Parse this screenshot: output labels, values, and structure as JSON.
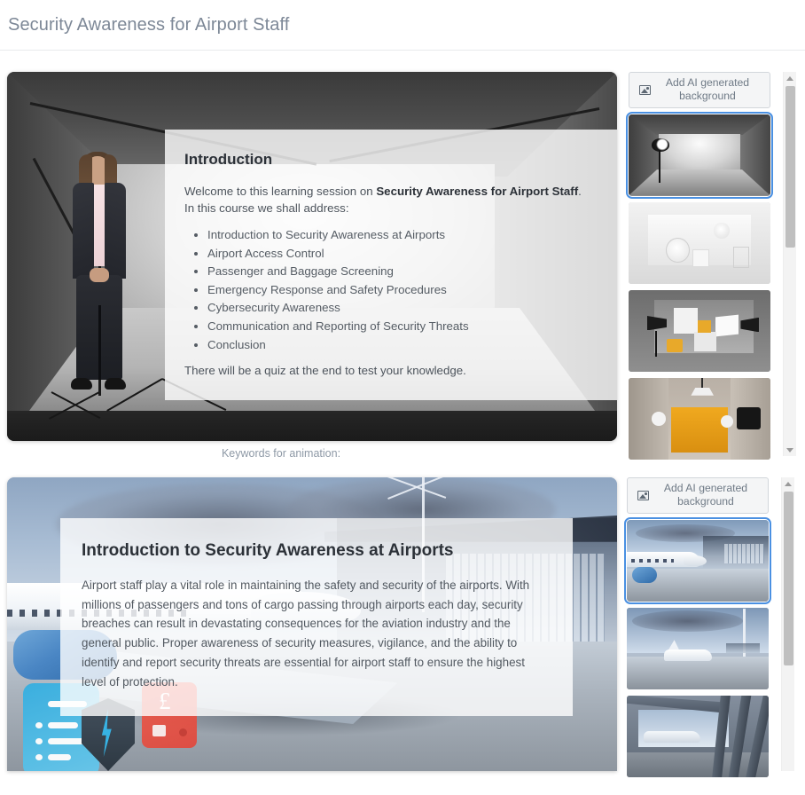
{
  "header": {
    "title": "Security Awareness for Airport Staff"
  },
  "slides": [
    {
      "heading": "Introduction",
      "intro_before": "Welcome to this learning session on ",
      "intro_bold": "Security Awareness for Airport Staff",
      "intro_after": ".",
      "intro_line2": "In this course we shall address:",
      "bullets": [
        "Introduction to Security Awareness at Airports",
        "Airport Access Control",
        "Passenger and Baggage Screening",
        "Emergency Response and Safety Procedures",
        "Cybersecurity Awareness",
        "Communication and Reporting of Security Threats",
        "Conclusion"
      ],
      "outro": "There will be a quiz at the end to test your knowledge.",
      "keywords_label": "Keywords for animation:",
      "panel": {
        "add_bg_label": "Add AI generated background",
        "add_bg_icon": "image-icon",
        "thumbnails": [
          {
            "name": "grey-studio-softbox",
            "selected": true
          },
          {
            "name": "white-studio-reflector",
            "selected": false
          },
          {
            "name": "yellow-accent-studio",
            "selected": false
          },
          {
            "name": "warm-yellow-studio",
            "selected": false
          }
        ]
      }
    },
    {
      "heading": "Introduction to Security Awareness at Airports",
      "body": "Airport staff play a vital role in maintaining the safety and security of the airports. With millions of passengers and tons of cargo passing through airports each day, security breaches can result in devastating consequences for the aviation industry and the general public. Proper awareness of security measures, vigilance, and the ability to identify and report security threats are essential for airport staff to ensure the highest level of protection.",
      "panel": {
        "add_bg_label": "Add AI generated background",
        "add_bg_icon": "image-icon",
        "thumbnails": [
          {
            "name": "airliner-at-terminal",
            "selected": true
          },
          {
            "name": "jet-on-apron",
            "selected": false
          },
          {
            "name": "terminal-structure-view",
            "selected": false
          }
        ]
      }
    }
  ],
  "scrollbars": {
    "up_arrow_icon": "triangle-up-icon",
    "down_arrow_icon": "triangle-down-icon"
  },
  "colors": {
    "title": "#7d8897",
    "selection": "#4a90e2",
    "button_bg": "#f4f5f6",
    "button_border": "#d2d6db"
  }
}
